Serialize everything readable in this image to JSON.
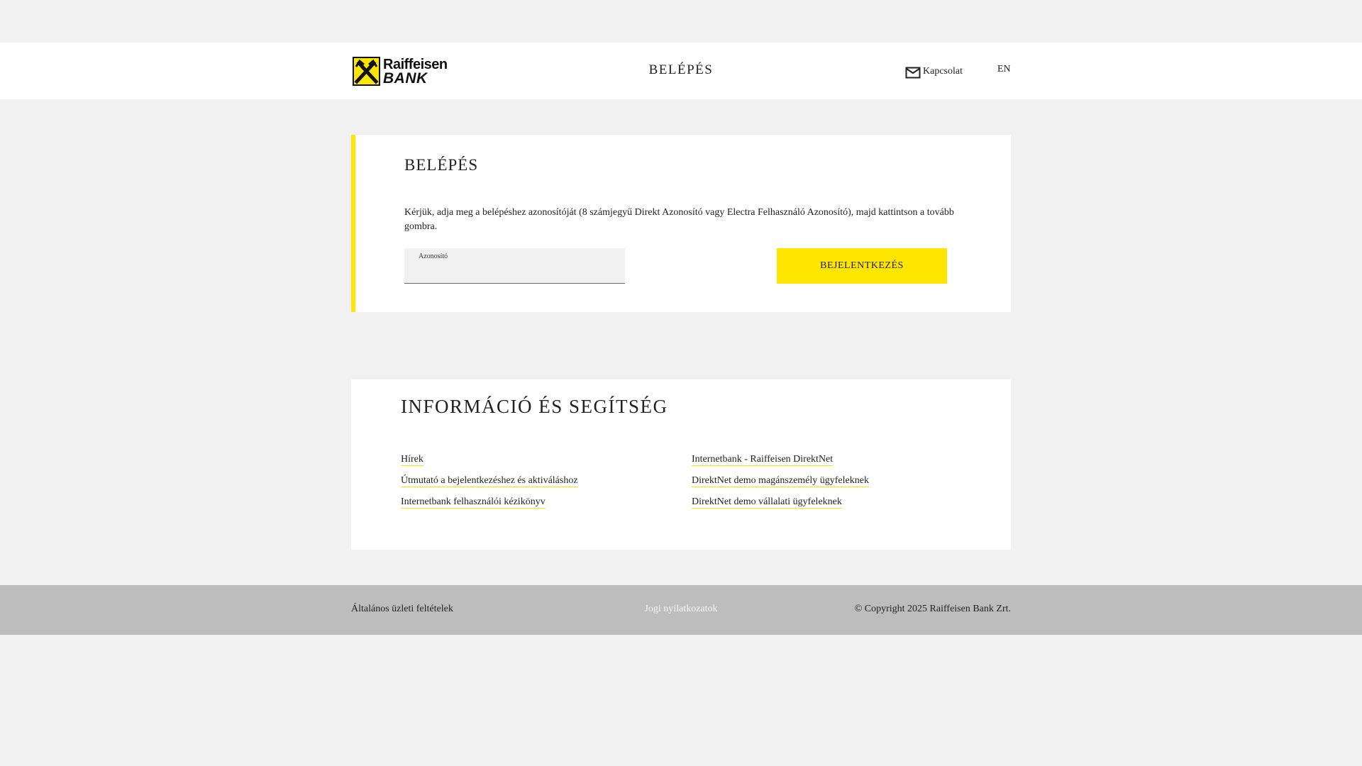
{
  "header": {
    "logo": {
      "line1": "Raiffeisen",
      "line2": "BANK",
      "mark_color": "#fee600"
    },
    "title": "BELÉPÉS",
    "contact": {
      "icon": "mail-icon",
      "label": "Kapcsolat"
    },
    "language": "EN"
  },
  "login": {
    "title": "BELÉPÉS",
    "description": "Kérjük, adja meg a belépéshez azonosítóját (8 számjegyű Direkt Azonosító vagy Electra Felhasználó Azonosító), majd kattintson a tovább gombra.",
    "id_field": {
      "label": "Azonosító",
      "value": ""
    },
    "submit_label": "BEJELENTKEZÉS",
    "accent_color": "#fee600"
  },
  "info": {
    "title": "INFORMÁCIÓ ÉS SEGÍTSÉG",
    "links_left": [
      "Hírek",
      "Útmutató a bejelentkezéshez és aktiváláshoz",
      "Internetbank felhasználói kézikönyv"
    ],
    "links_right": [
      "Internetbank - Raiffeisen DirektNet",
      "DirektNet demo magánszemély ügyfeleknek",
      "DirektNet demo vállalati ügyfeleknek"
    ]
  },
  "footer": {
    "terms": "Általános üzleti feltételek",
    "legal": "Jogi nyilatkozatok",
    "copyright": "© Copyright 2025 Raiffeisen Bank Zrt."
  }
}
